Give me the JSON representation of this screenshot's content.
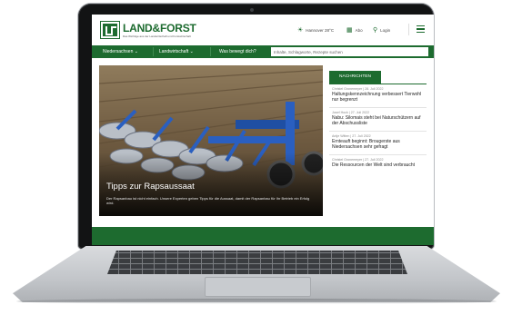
{
  "site": {
    "logo_text": "LAND&FORST",
    "logo_tagline": "Das Wichtige aus der Landwirtschaft und Forstwirtschaft"
  },
  "header": {
    "weather": "Hannover 28°C",
    "epaper": "Abo",
    "login": "Login"
  },
  "nav": {
    "items": [
      "Niedersachsen ⌄",
      "Landwirtschaft ⌄",
      "Was bewegt dich?"
    ],
    "search_placeholder": "Inhalte, Schlagworte, Rezepte suchen"
  },
  "hero": {
    "title": "Tipps zur Rapsaussaat",
    "description": "Der Rapsanbau ist nicht einfach. Unsere Experten geben Tipps für die Aussaat, damit der Rapsanbau für Ihr Betrieb ein Erfolg wird."
  },
  "sidebar": {
    "tab_label": "NACHRICHTEN",
    "news": [
      {
        "meta": "Christel Gronemeyer | 28. Juli 2022",
        "title": "Haltungskennzeichnung verbessert Tierwohl nur begrenzt"
      },
      {
        "meta": "Josef Hock | 27. Juli 2022",
        "title": "Nabu: Silomais steht bei Naturschützern auf der Abschussliste"
      },
      {
        "meta": "Antje Witten | 27. Juli 2022",
        "title": "Ernteauft beginnt: Brougerste aus Niedersachsen sehr gefragt"
      },
      {
        "meta": "Christel Gronemeyer | 27. Juli 2022",
        "title": "Die Ressourcen der Welt sind verbraucht"
      }
    ]
  },
  "colors": {
    "brand_green": "#1d6b2f",
    "laptop_bezel": "#121314",
    "laptop_body": "#c2c5c9"
  },
  "icons": [
    "sun-icon",
    "calendar-icon",
    "user-icon",
    "menu-icon",
    "chevron-down-icon"
  ]
}
